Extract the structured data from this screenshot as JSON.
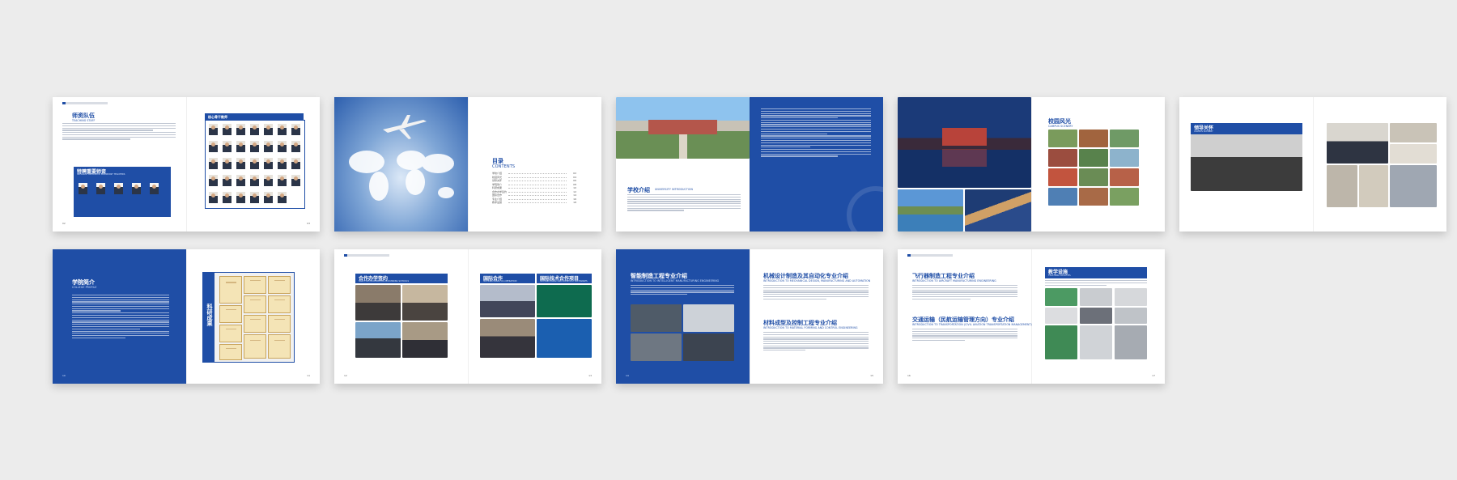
{
  "spreads": {
    "teachers": {
      "title": "师资队伍",
      "subtitle": "TEACHING STAFF",
      "bar1_title": "特聘重要师资",
      "bar1_sub": "SPECIALLY APPOINTED IMPORTANT TEACHERS",
      "bar2_title": "核心骨干教师",
      "bar2_sub": "CORE TEACHERS",
      "page_left": "02",
      "page_right": "03"
    },
    "contents": {
      "title": "目录",
      "subtitle": "CONTENTS",
      "items": [
        {
          "label": "学校介绍",
          "page": "02"
        },
        {
          "label": "校园风光",
          "page": "04"
        },
        {
          "label": "领导关怀",
          "page": "06"
        },
        {
          "label": "学院简介",
          "page": "08"
        },
        {
          "label": "科研成果",
          "page": "10"
        },
        {
          "label": "合作办学签约",
          "page": "12"
        },
        {
          "label": "国际合作",
          "page": "14"
        },
        {
          "label": "专业介绍",
          "page": "16"
        },
        {
          "label": "教学设施",
          "page": "18"
        }
      ]
    },
    "school_intro": {
      "title": "学校介绍",
      "subtitle": "UNIVERSITY INTRODUCTION",
      "page_left": "04",
      "page_right": "05"
    },
    "campus": {
      "title": "校园风光",
      "subtitle": "CAMPUS SCENERY",
      "page_left": "06",
      "page_right": "07"
    },
    "leaders": {
      "title": "领导关怀",
      "subtitle": "CAMPUS SCENERY",
      "page_left": "08",
      "page_right": "09"
    },
    "college": {
      "title": "学院简介",
      "subtitle": "COLLEGE PROFILE",
      "research_title": "科研成果",
      "page_left": "10",
      "page_right": "11"
    },
    "cooperation": {
      "title": "合作办学签约",
      "subtitle": "SIGN FOR COOPERATION IN RUNNING SCHOOLS",
      "intl_title": "国际合作",
      "intl_sub": "INTERNATIONAL CO-OPERATION",
      "exchange_title": "国际技术合作项目",
      "exchange_sub": "INTERNATIONAL AND DOMESTIC EXCHANGES",
      "page_left": "12",
      "page_right": "13"
    },
    "majors1": {
      "title": "智能制造工程专业介绍",
      "subtitle": "INTRODUCTION TO INTELLIGENT MANUFACTURING ENGINEERING",
      "title2": "机械设计制造及其自动化专业介绍",
      "subtitle2": "INTRODUCTION TO MECHANICAL DESIGN, MANUFACTURING AND AUTOMATION",
      "title3": "材料成型及控制工程专业介绍",
      "subtitle3": "INTRODUCTION TO MATERIAL FORMING AND CONTROL ENGINEERING",
      "page_left": "14",
      "page_right": "15"
    },
    "majors2": {
      "title": "飞行器制造工程专业介绍",
      "subtitle": "INTRODUCTION TO AIRCRAFT MANUFACTURING ENGINEERING",
      "title2": "交通运输（民航运输管理方向）专业介绍",
      "subtitle2": "INTRODUCTION TO TRANSPORTATION (CIVIL AVIATION TRANSPORTATION MANAGEMENT)",
      "facilities_title": "教学设施",
      "facilities_sub": "TEACHING FACILITIES",
      "page_left": "16",
      "page_right": "17"
    }
  },
  "colors": {
    "brand_blue": "#1f4ea6",
    "background": "#ececec"
  }
}
